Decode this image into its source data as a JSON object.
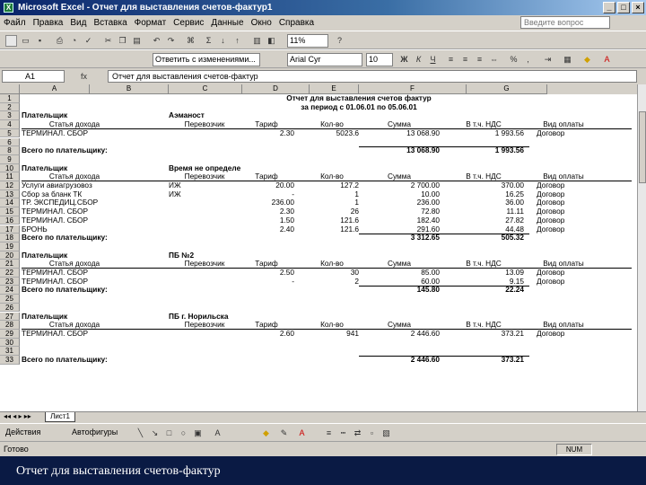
{
  "window": {
    "title": "Microsoft Excel - Отчет для выставления счетов-фактур1",
    "app_icon": "excel-icon"
  },
  "menu": {
    "items": [
      "Файл",
      "Правка",
      "Вид",
      "Вставка",
      "Формат",
      "Сервис",
      "Данные",
      "Окно",
      "Справка"
    ],
    "help_placeholder": "Введите вопрос"
  },
  "toolbar": {
    "zoom": "11%",
    "font": "Arial Cyr",
    "size": "10",
    "formatting_label": "Ответить с изменениями..."
  },
  "formula_bar": {
    "cell": "A1",
    "fx": "fx",
    "content": "Отчет для выставления счетов-фактур"
  },
  "grid": {
    "columns": [
      "A",
      "B",
      "C",
      "D",
      "E",
      "F",
      "G"
    ],
    "title1": "Отчет для выставления счетов фактур",
    "title2": "за период с 01.06.01 по 05.06.01",
    "rows": [
      {
        "n": "1"
      },
      {
        "n": "2"
      },
      {
        "n": "3",
        "a": "Плательщик",
        "b": "Аэманост",
        "bold": true
      },
      {
        "n": "4",
        "a": "Статья дохода",
        "b": "Перевозчик",
        "c": "Тариф",
        "d": "Кол-во",
        "e": "Сумма",
        "f": "В т.ч. НДС",
        "g": "Вид оплаты",
        "hdr": true
      },
      {
        "n": "5",
        "a": "ТЕРМИНАЛ. СБОР",
        "c": "2.30",
        "d": "5023.6",
        "e": "13 068.90",
        "f": "1 993.56",
        "g": "Договор"
      },
      {
        "n": "6"
      },
      {
        "n": "8",
        "a": "Всего по плательщику:",
        "e": "13 068.90",
        "f": "1 993.56",
        "total": true
      },
      {
        "n": "9"
      },
      {
        "n": "10",
        "a": "Плательщик",
        "b": "Время не определен",
        "bold": true
      },
      {
        "n": "11",
        "a": "Статья дохода",
        "b": "Перевозчик",
        "c": "Тариф",
        "d": "Кол-во",
        "e": "Сумма",
        "f": "В т.ч. НДС",
        "g": "Вид оплаты",
        "hdr": true
      },
      {
        "n": "12",
        "a": "Услуги авиагрузовоз",
        "b": "ИЖ",
        "c": "20.00",
        "d": "127.2",
        "e": "2 700.00",
        "f": "370.00",
        "g": "Договор"
      },
      {
        "n": "13",
        "a": "Сбор за бланк ТК",
        "b": "ИЖ",
        "c": "-",
        "d": "1",
        "e": "10.00",
        "f": "16.25",
        "g": "Договор"
      },
      {
        "n": "14",
        "a": "ТР. ЭКСПЕДИЦ.СБОР",
        "c": "236.00",
        "d": "1",
        "e": "236.00",
        "f": "36.00",
        "g": "Договор"
      },
      {
        "n": "15",
        "a": "ТЕРМИНАЛ. СБОР",
        "c": "2.30",
        "d": "26",
        "e": "72.80",
        "f": "11.11",
        "g": "Договор"
      },
      {
        "n": "16",
        "a": "ТЕРМИНАЛ. СБОР",
        "c": "1.50",
        "d": "121.6",
        "e": "182.40",
        "f": "27.82",
        "g": "Договор"
      },
      {
        "n": "17",
        "a": "БРОНЬ",
        "c": "2.40",
        "d": "121.6",
        "e": "291.60",
        "f": "44.48",
        "g": "Договор"
      },
      {
        "n": "18",
        "a": "Всего по плательщику:",
        "e": "3 312.65",
        "f": "505.32",
        "total": true
      },
      {
        "n": "19"
      },
      {
        "n": "20",
        "a": "Плательщик",
        "b": "ПБ №2",
        "bold": true
      },
      {
        "n": "21",
        "a": "Статья дохода",
        "b": "Перевозчик",
        "c": "Тариф",
        "d": "Кол-во",
        "e": "Сумма",
        "f": "В т.ч. НДС",
        "g": "Вид оплаты",
        "hdr": true
      },
      {
        "n": "22",
        "a": "ТЕРМИНАЛ. СБОР",
        "c": "2.50",
        "d": "30",
        "e": "85.00",
        "f": "13.09",
        "g": "Договор"
      },
      {
        "n": "23",
        "a": "ТЕРМИНАЛ. СБОР",
        "c": "-",
        "d": "2",
        "e": "60.00",
        "f": "9.15",
        "g": "Договор"
      },
      {
        "n": "24",
        "a": "Всего по плательщику:",
        "e": "145.80",
        "f": "22.24",
        "total": true
      },
      {
        "n": "25"
      },
      {
        "n": "26"
      },
      {
        "n": "27",
        "a": "Плательщик",
        "b": "ПБ г. Норильска",
        "bold": true
      },
      {
        "n": "28",
        "a": "Статья дохода",
        "b": "Перевозчик",
        "c": "Тариф",
        "d": "Кол-во",
        "e": "Сумма",
        "f": "В т.ч. НДС",
        "g": "Вид оплаты",
        "hdr": true
      },
      {
        "n": "29",
        "a": "ТЕРМИНАЛ. СБОР",
        "c": "2.60",
        "d": "941",
        "e": "2 446.60",
        "f": "373.21",
        "g": "Договор"
      },
      {
        "n": "30"
      },
      {
        "n": "31"
      },
      {
        "n": "33",
        "a": "Всего по плательщику:",
        "e": "2 446.60",
        "f": "373.21",
        "total": true
      }
    ]
  },
  "sheet_tab": "Лист1",
  "drawing": {
    "actions": "Действия",
    "autoshapes": "Автофигуры"
  },
  "status": {
    "text": "Готово",
    "num": "NUM"
  },
  "caption": "Отчет для выставления счетов-фактур"
}
